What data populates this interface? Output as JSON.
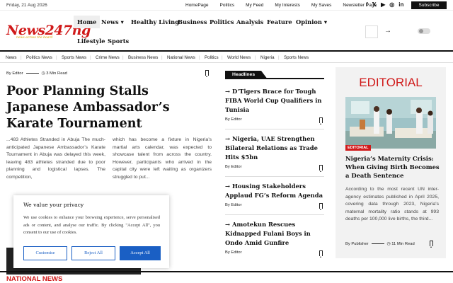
{
  "topbar": {
    "date": "Friday, 21 Aug 2026",
    "links": [
      "HomePage",
      "Politics",
      "My Feed",
      "My Interests",
      "My Saves",
      "Newsletter Page"
    ],
    "subscribe": "Subscribe"
  },
  "logo": {
    "text": "News247ng",
    "tagline": "news across the board"
  },
  "nav": {
    "items": [
      {
        "label": "Home"
      },
      {
        "label": "News"
      },
      {
        "label": "Healthy Living"
      },
      {
        "label": "Business"
      },
      {
        "label": "Politics"
      },
      {
        "label": "Analysis"
      },
      {
        "label": "Feature"
      },
      {
        "label": "Opinion"
      },
      {
        "label": "Lifestyle"
      },
      {
        "label": "Sports"
      }
    ]
  },
  "categories": [
    "News",
    "Politics News",
    "Sports News",
    "Crime News",
    "Business News",
    "National News",
    "Politics",
    "World News",
    "Nigeria",
    "Sports News"
  ],
  "main_article": {
    "author": "By Editor",
    "read_time": "3 Min Read",
    "title": "Poor Planning Stalls Japanese Ambassador’s Karate Tournament",
    "col1": "...483 Athletes Stranded in Abuja The much-anticipated Japanese Ambassador’s Karate Tournament in Abuja was delayed this week, leaving 483 athletes stranded due to poor planning and logistical lapses. The competition,",
    "col2": "which has become a fixture in Nigeria’s martial arts calendar, was expected to showcase talent from across the country. However, participants who arrived in the capital city were left waiting as organizers struggled to put..."
  },
  "headlines": {
    "label": "Headlines",
    "items": [
      {
        "title": "D’Tigers Brace for Tough FIBA World Cup Qualifiers in Tunisia",
        "author": "By Editor"
      },
      {
        "title": "Nigeria, UAE Strengthen Bilateral Relations as Trade Hits $5bn",
        "author": "By Editor"
      },
      {
        "title": "Housing Stakeholders Applaud FG’s Reform Agenda",
        "author": "By Editor"
      },
      {
        "title": "Amotekun Rescues Kidnapped Fulani Boys in Ondo Amid Gunfire",
        "author": "By Editor"
      }
    ]
  },
  "editorial": {
    "heading": "EDITORIAL",
    "tag": "EDITORIAL",
    "title": "Nigeria’s Maternity Crisis: When Giving Birth Becomes a Death Sentence",
    "text": "According to the most recent UN inter-agency estimates published in April 2025, covering data through 2023, Nigeria's maternal mortality ratio stands at 993 deaths per 100,000 live births, the third...",
    "author": "By Publisher",
    "read_time": "11 Min Read"
  },
  "cookie": {
    "title": "We value your privacy",
    "text": "We use cookies to enhance your browsing experience, serve personalised ads or content, and analyse our traffic. By clicking \"Accept All\", you consent to our use of cookies.",
    "customise": "Customise",
    "reject": "Reject All",
    "accept": "Accept All"
  },
  "bottom": {
    "section": "NATIONAL NEWS"
  },
  "colors": {
    "brand_red": "#d01a1a",
    "accent_blue": "#1a5fc4"
  }
}
